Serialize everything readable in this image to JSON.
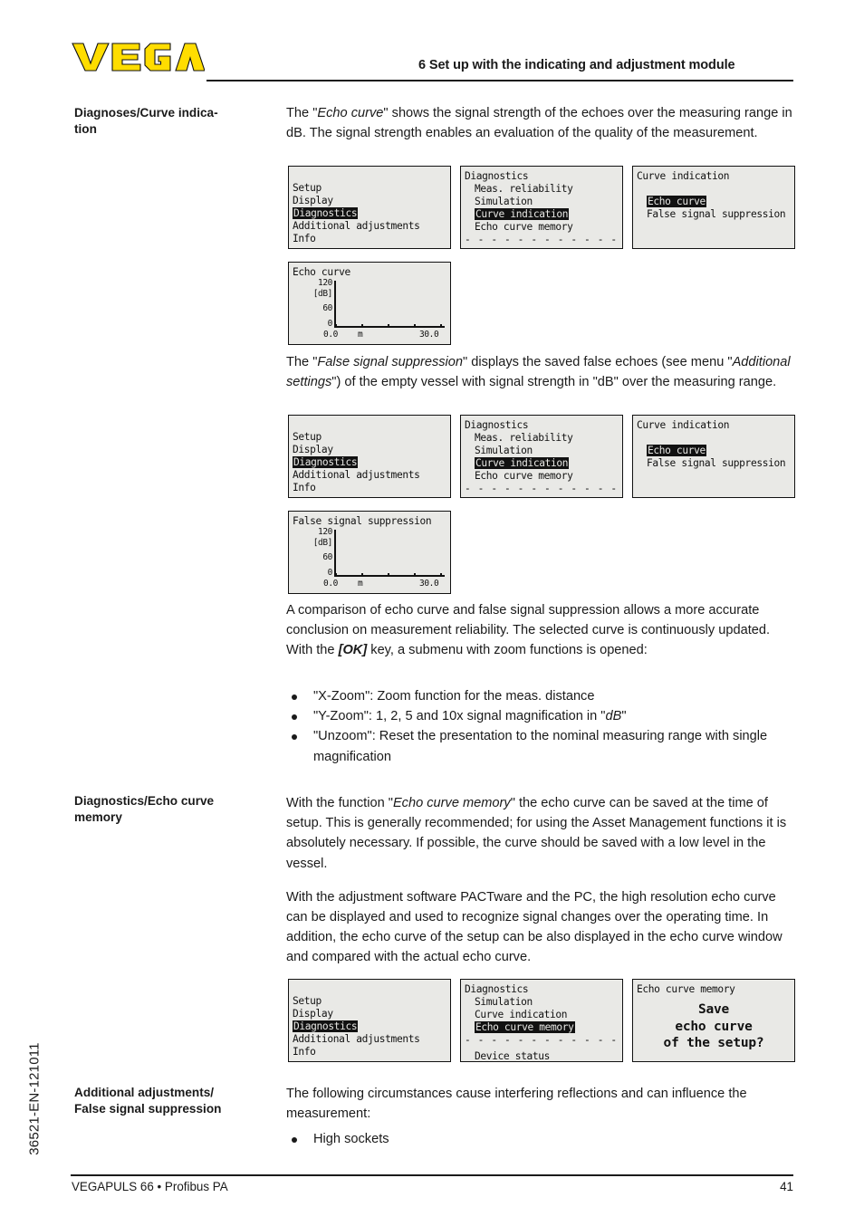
{
  "header": {
    "logo_text": "VEGA",
    "logo_color": "#ffdd00",
    "title": "6 Set up with the indicating and adjustment module"
  },
  "side_code": "36521-EN-121011",
  "sections": {
    "diagnoses_curve": {
      "margin_heading": "Diagnoses/Curve indica-\ntion",
      "para1_a": "The \"",
      "para1_em": "Echo curve",
      "para1_b": "\" shows the signal strength of the echoes over the measuring range in dB. The signal strength enables an evaluation of the quality of the measurement.",
      "para2_a": "The \"",
      "para2_em1": "False signal suppression",
      "para2_b": "\" displays the saved false echoes (see menu \"",
      "para2_em2": "Additional settings",
      "para2_c": "\") of the empty vessel with signal strength in \"dB\" over the measuring range.",
      "para3_a": "A comparison of echo curve and false signal suppression allows a more accurate conclusion on measurement reliability. The selected curve is continuously updated. With the ",
      "para3_ok": "[OK]",
      "para3_b": " key, a submenu with zoom functions is opened:",
      "bullets": [
        {
          "pre": "\"X-Zoom\": Zoom function for the meas. distance",
          "em": "",
          "post": ""
        },
        {
          "pre": "\"Y-Zoom\": 1, 2, 5 and 10x signal magnification in \"",
          "em": "dB",
          "post": "\""
        },
        {
          "pre": "\"Unzoom\": Reset the presentation to the nominal measuring range with single magnification",
          "em": "",
          "post": ""
        }
      ]
    },
    "echo_curve_memory": {
      "margin_heading": "Diagnostics/Echo curve\nmemory",
      "para1_a": "With the function \"",
      "para1_em": "Echo curve memory",
      "para1_b": "\" the echo curve can be saved at the time of setup. This is generally recommended; for using the Asset Management functions it is absolutely necessary. If possible, the curve should be saved with a low level in the vessel.",
      "para2": "With the adjustment software PACTware and the PC, the high resolution echo curve can be displayed and used to recognize signal changes over the operating time. In addition, the echo curve of the setup can be also displayed in the echo curve window and compared with the actual echo curve."
    },
    "additional_adjustments": {
      "margin_heading": "Additional adjustments/\nFalse signal suppression",
      "para1": "The following circumstances cause interfering reflections and can influence the measurement:",
      "bullets": [
        "High sockets"
      ]
    }
  },
  "screens": {
    "menu_main": {
      "title": "",
      "lines": [
        "Setup",
        "Display",
        "Diagnostics",
        "Additional adjustments",
        "Info"
      ],
      "highlight": "Diagnostics"
    },
    "menu_diagnostics_1": {
      "title": "Diagnostics",
      "lines": [
        "Meas. reliability",
        "Simulation",
        "Curve indication",
        "Echo curve memory"
      ],
      "highlight": "Curve indication",
      "divider": "- - - - - - - - - - - - - - - -",
      "scroll_arrow": "▼"
    },
    "menu_curve_indication": {
      "title": "Curve indication",
      "lines": [
        "Echo curve",
        "False signal suppression"
      ],
      "highlight": "Echo curve"
    },
    "menu_diagnostics_2": {
      "title": "Diagnostics",
      "lines": [
        "Simulation",
        "Curve indication",
        "Echo curve memory"
      ],
      "highlight": "Echo curve memory",
      "divider": "- - - - - - - - - - - - - - - -",
      "after_divider": "Device status",
      "scroll_arrow": "▼"
    },
    "menu_echo_curve_memory": {
      "title": "Echo curve memory",
      "prompt_line1": "Save",
      "prompt_line2": "echo curve",
      "prompt_line3": "of the setup?"
    }
  },
  "chart_data": [
    {
      "type": "line",
      "title": "Echo curve",
      "ylabel": "[dB]",
      "xlabel": "m",
      "yticks": [
        "120",
        "60",
        "0"
      ],
      "ylim": [
        0,
        120
      ],
      "xticks": [
        "0.0",
        "30.0"
      ],
      "xlim": [
        0.0,
        30.0
      ],
      "series": [
        {
          "name": "echo curve",
          "x": [],
          "y": []
        }
      ],
      "grid": false,
      "legend": "none"
    },
    {
      "type": "line",
      "title": "False signal suppression",
      "ylabel": "[dB]",
      "xlabel": "m",
      "yticks": [
        "120",
        "60",
        "0"
      ],
      "ylim": [
        0,
        120
      ],
      "xticks": [
        "0.0",
        "30.0"
      ],
      "xlim": [
        0.0,
        30.0
      ],
      "series": [
        {
          "name": "false signal suppression",
          "x": [],
          "y": []
        }
      ],
      "grid": false,
      "legend": "none"
    }
  ],
  "footer": {
    "left": "VEGAPULS 66 • Profibus PA",
    "page_number": "41"
  }
}
